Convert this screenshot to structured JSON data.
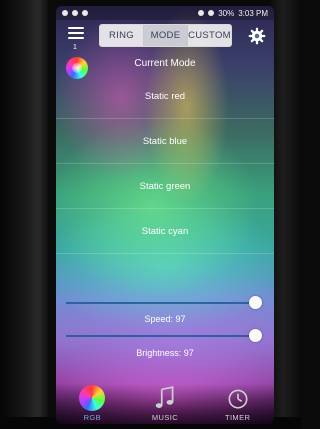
{
  "status_bar": {
    "battery": "30%",
    "time": "3:03 PM"
  },
  "top_bar": {
    "menu_badge": "1",
    "tabs": [
      {
        "label": "RING",
        "active": false
      },
      {
        "label": "MODE",
        "active": true
      },
      {
        "label": "CUSTOM",
        "active": false
      }
    ]
  },
  "mode_list": {
    "title": "Current Mode",
    "items": [
      "Static red",
      "Static blue",
      "Static green",
      "Static cyan"
    ]
  },
  "speed": {
    "label": "Speed: 97",
    "value": 97
  },
  "brightness": {
    "label": "Brightness: 97",
    "value": 97
  },
  "bottom_nav": [
    {
      "label": "RGB",
      "icon": "color-wheel-icon",
      "active": true
    },
    {
      "label": "MUSIC",
      "icon": "music-note-icon",
      "active": false
    },
    {
      "label": "TIMER",
      "icon": "timer-icon",
      "active": false
    }
  ],
  "colors": {
    "accent": "#7aa7e0",
    "slider_track": "#1e5a96",
    "segment_active": "#c9ccd3"
  }
}
